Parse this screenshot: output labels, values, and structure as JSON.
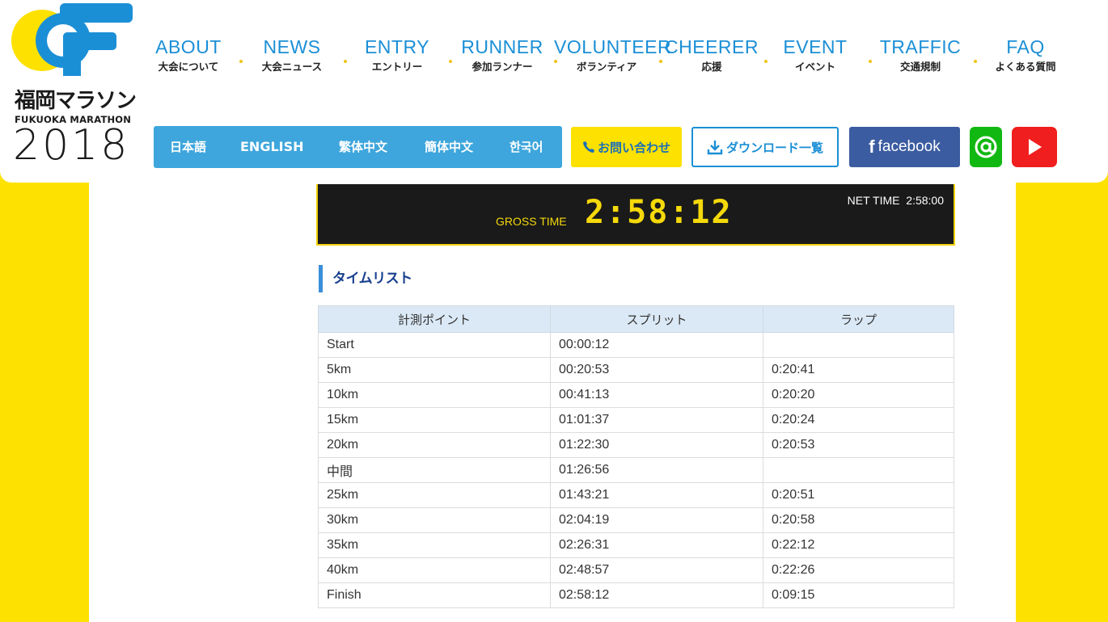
{
  "logo": {
    "title_jp": "福岡マラソン",
    "title_en": "FUKUOKA MARATHON",
    "year": "2018",
    "colors": {
      "blue": "#1b8fd6",
      "yellow": "#fde100"
    }
  },
  "nav": [
    {
      "en": "ABOUT",
      "jp": "大会について"
    },
    {
      "en": "NEWS",
      "jp": "大会ニュース"
    },
    {
      "en": "ENTRY",
      "jp": "エントリー"
    },
    {
      "en": "RUNNER",
      "jp": "参加ランナー"
    },
    {
      "en": "VOLUNTEER",
      "jp": "ボランティア"
    },
    {
      "en": "CHEERER",
      "jp": "応援"
    },
    {
      "en": "EVENT",
      "jp": "イベント"
    },
    {
      "en": "TRAFFIC",
      "jp": "交通規制"
    },
    {
      "en": "FAQ",
      "jp": "よくある質問"
    }
  ],
  "languages": [
    "日本語",
    "ENGLISH",
    "繁体中文",
    "簡体中文",
    "한국어"
  ],
  "buttons": {
    "contact": "お問い合わせ",
    "download": "ダウンロード一覧",
    "facebook": "facebook",
    "line_icon": "line-at-icon",
    "youtube_icon": "youtube-play-icon"
  },
  "timer": {
    "gross_label": "GROSS TIME",
    "gross_value": "2:58:12",
    "net_label": "NET TIME",
    "net_value": "2:58:00"
  },
  "section_title": "タイムリスト",
  "table": {
    "headers": [
      "計測ポイント",
      "スプリット",
      "ラップ"
    ],
    "rows": [
      [
        "Start",
        "00:00:12",
        ""
      ],
      [
        "5km",
        "00:20:53",
        "0:20:41"
      ],
      [
        "10km",
        "00:41:13",
        "0:20:20"
      ],
      [
        "15km",
        "01:01:37",
        "0:20:24"
      ],
      [
        "20km",
        "01:22:30",
        "0:20:53"
      ],
      [
        "中間",
        "01:26:56",
        ""
      ],
      [
        "25km",
        "01:43:21",
        "0:20:51"
      ],
      [
        "30km",
        "02:04:19",
        "0:20:58"
      ],
      [
        "35km",
        "02:26:31",
        "0:22:12"
      ],
      [
        "40km",
        "02:48:57",
        "0:22:26"
      ],
      [
        "Finish",
        "02:58:12",
        "0:09:15"
      ]
    ]
  }
}
